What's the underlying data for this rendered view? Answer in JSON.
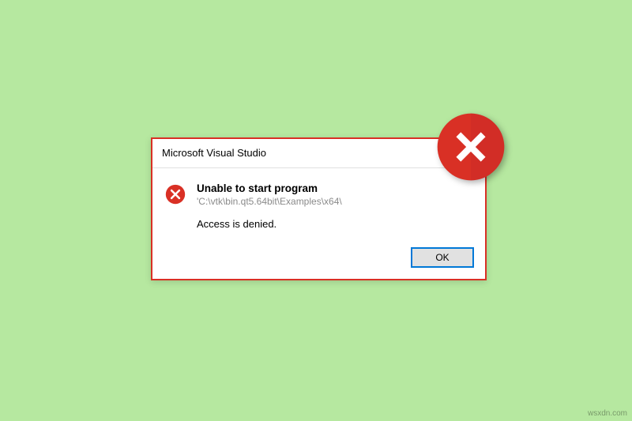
{
  "dialog": {
    "title": "Microsoft Visual Studio",
    "message_main": "Unable to start program",
    "message_path": "'C:\\vtk\\bin.qt5.64bit\\Examples\\x64\\",
    "message_secondary": "Access is denied.",
    "ok_label": "OK"
  },
  "icons": {
    "error_color": "#d93025",
    "badge_color": "#d93025",
    "badge_shadow": "#b12a21"
  },
  "watermark": "wsxdn.com"
}
